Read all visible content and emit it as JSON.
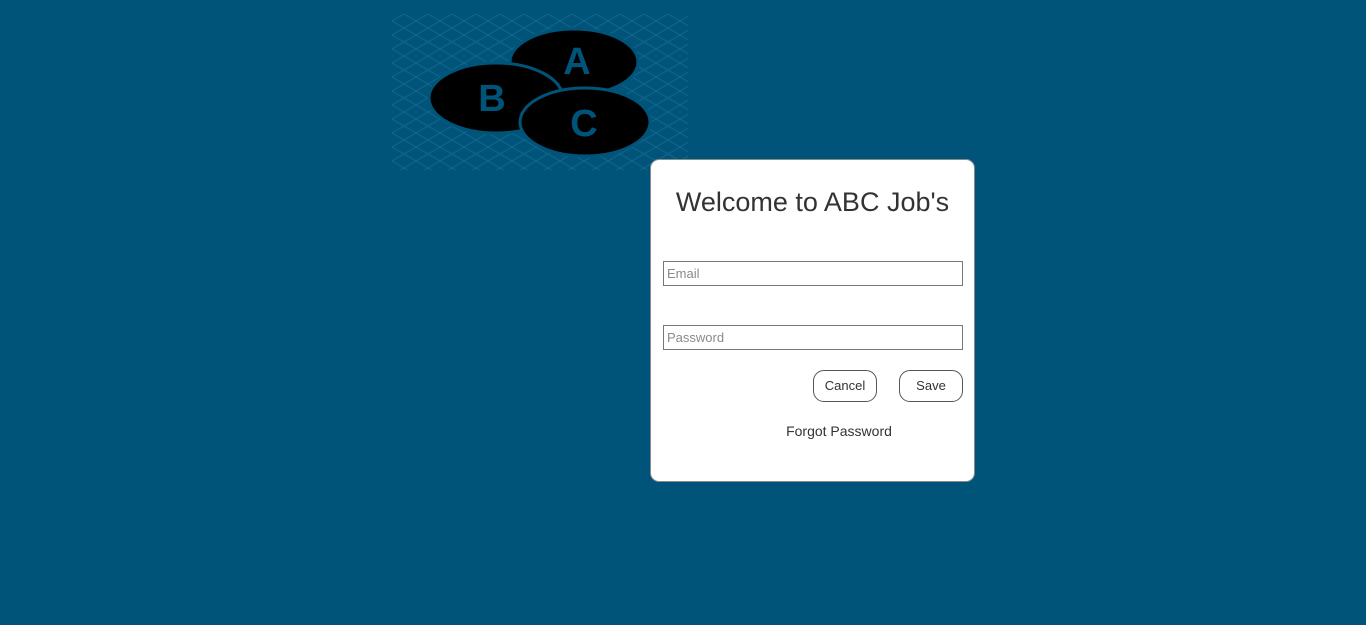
{
  "logo": {
    "letters": [
      "A",
      "B",
      "C"
    ],
    "colors": {
      "circle": "#000000",
      "letter": "#005479",
      "pattern": "#1a6f94"
    }
  },
  "login": {
    "title": "Welcome to ABC Job's",
    "email_placeholder": "Email",
    "password_placeholder": "Password",
    "cancel_label": "Cancel",
    "save_label": "Save",
    "forgot_label": "Forgot Password"
  },
  "colors": {
    "background": "#005479",
    "card": "#ffffff",
    "text": "#333333"
  }
}
